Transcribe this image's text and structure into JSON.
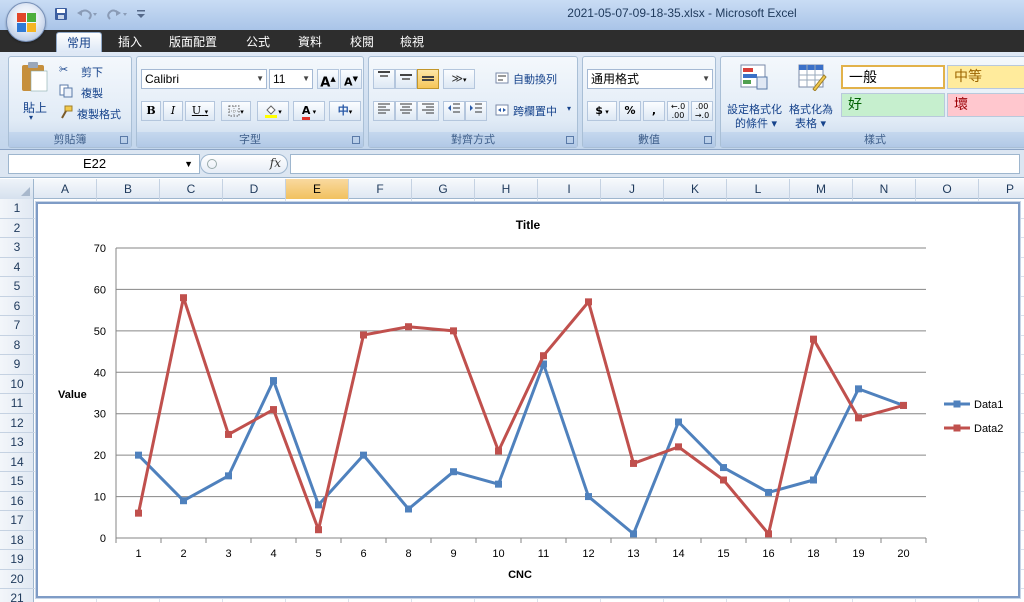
{
  "window": {
    "title": "2021-05-07-09-18-35.xlsx - Microsoft Excel"
  },
  "qat": [
    "save-icon",
    "undo-icon",
    "redo-icon",
    "customize-icon"
  ],
  "tabs": [
    "常用",
    "插入",
    "版面配置",
    "公式",
    "資料",
    "校閱",
    "檢視"
  ],
  "active_tab": "常用",
  "ribbon": {
    "clipboard": {
      "paste": "貼上",
      "cut": "剪下",
      "copy": "複製",
      "format_painter": "複製格式",
      "label": "剪貼簿"
    },
    "font": {
      "name": "Calibri",
      "size": "11",
      "grow": "A",
      "shrink": "A",
      "bold": "B",
      "italic": "I",
      "underline": "U",
      "font_color": "A",
      "label": "字型"
    },
    "alignment": {
      "wrap": "自動換列",
      "merge": "跨欄置中",
      "label": "對齊方式"
    },
    "number": {
      "format": "通用格式",
      "currency": "$",
      "percent": "%",
      "comma": ",",
      "inc_dec": ".0 .00",
      "dec_dec": ".00 .0",
      "label": "數值"
    },
    "styles": {
      "conditional": "設定格式化\n的條件",
      "conditional_1": "設定格式化",
      "conditional_2": "的條件",
      "table_1": "格式化為",
      "table_2": "表格",
      "normal": "一般",
      "neutral": "中等",
      "good": "好",
      "bad": "壞",
      "label": "樣式"
    }
  },
  "formula_bar": {
    "name_box": "E22",
    "fx": "fx",
    "formula": ""
  },
  "columns": [
    "A",
    "B",
    "C",
    "D",
    "E",
    "F",
    "G",
    "H",
    "I",
    "J",
    "K",
    "L",
    "M",
    "N",
    "O",
    "P"
  ],
  "selected_column": "E",
  "rows": [
    "1",
    "2",
    "3",
    "4",
    "5",
    "6",
    "7",
    "8",
    "9",
    "10",
    "11",
    "12",
    "13",
    "14",
    "15",
    "16",
    "17",
    "18",
    "19",
    "20",
    "21"
  ],
  "colors": {
    "data1": "#4f81bd",
    "data2": "#c0504d",
    "style_normal": "#ffffff",
    "style_neutral": "#ffeb9c",
    "style_good": "#c6efce",
    "style_bad": "#ffc7ce"
  },
  "chart_data": {
    "type": "line",
    "title": "Title",
    "xlabel": "CNC",
    "ylabel": "Value",
    "categories": [
      "1",
      "2",
      "3",
      "4",
      "5",
      "6",
      "8",
      "9",
      "10",
      "11",
      "12",
      "13",
      "14",
      "15",
      "16",
      "18",
      "19",
      "20"
    ],
    "ylim": [
      0,
      70
    ],
    "yticks": [
      "0",
      "10",
      "20",
      "30",
      "40",
      "50",
      "60",
      "70"
    ],
    "grid": true,
    "legend": "right",
    "series": [
      {
        "name": "Data1",
        "values": [
          20,
          9,
          15,
          38,
          8,
          20,
          7,
          16,
          13,
          42,
          10,
          1,
          28,
          17,
          11,
          14,
          36,
          32
        ]
      },
      {
        "name": "Data2",
        "values": [
          6,
          58,
          25,
          31,
          2,
          49,
          51,
          50,
          21,
          44,
          57,
          18,
          22,
          14,
          1,
          48,
          29,
          32
        ]
      }
    ]
  }
}
